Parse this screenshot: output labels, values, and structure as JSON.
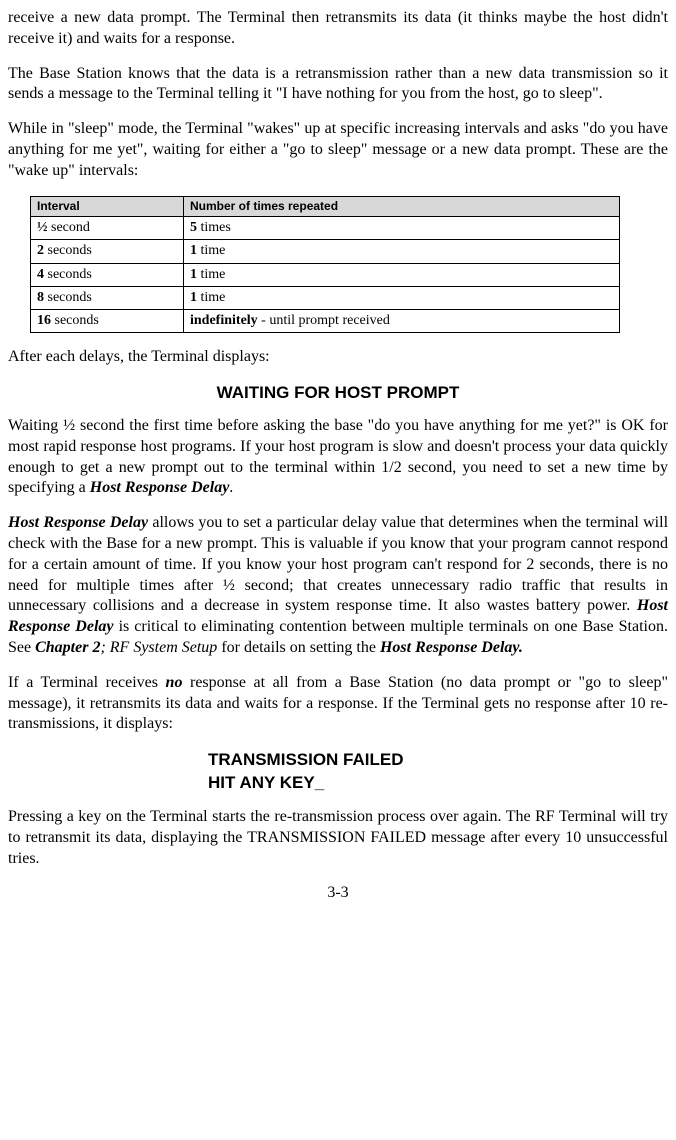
{
  "paragraphs": {
    "p1": "receive a new data prompt. The Terminal then retransmits its data (it thinks maybe the host didn't receive it) and waits for a response.",
    "p2": "The Base Station knows that the data is a retransmission rather than a new data transmission so it sends a message to the Terminal telling it \"I have nothing for you from the host, go to sleep\".",
    "p3": "While in \"sleep\" mode, the Terminal \"wakes\" up at specific increasing intervals and asks \"do you have anything for me yet\", waiting for either a \"go to sleep\" message or a new data prompt.  These are the \"wake up\" intervals:",
    "p4": "After each delays, the Terminal displays:",
    "p5a": "Waiting ½ second the first time before asking the base \"do you have anything for me yet?\" is OK for most rapid response host programs.  If your host program is slow and doesn't process your data quickly enough to get a new prompt out to the terminal within 1/2 second, you need to set a new time by specifying a ",
    "p5b": "Host Response Delay",
    "p5c": ".",
    "p6a": "Host Response Delay",
    "p6b": " allows you to set a particular delay value that determines when the terminal will check with the Base for a new prompt.  This is valuable if you know that your program cannot respond for a certain amount of time. If you know your host program can't respond for 2 seconds, there is no need for multiple times after ½ second; that creates unnecessary radio traffic that results in unnecessary collisions and a decrease in system response time. It also wastes battery power. ",
    "p6c": "Host Response Delay",
    "p6d": " is critical to eliminating contention between multiple terminals on one Base Station. See ",
    "p6e": "Chapter 2",
    "p6f": "; RF System Setup",
    "p6g": " for details on setting the ",
    "p6h": "Host Response Delay.",
    "p7a": "If a Terminal receives ",
    "p7b": "no",
    "p7c": " response at all from a Base Station (no data prompt or \"go to sleep\" message), it retransmits its data and waits for a response. If the Terminal gets no response after 10 re-transmissions, it displays:",
    "p8": "Pressing a key on the Terminal starts the re-transmission process over again. The RF Terminal will try to retransmit its data, displaying the TRANSMISSION FAILED message after every 10 unsuccessful tries."
  },
  "table": {
    "headers": {
      "c1": "Interval",
      "c2": "Number of times repeated"
    },
    "rows": [
      {
        "c1a": "½",
        "c1b": " second",
        "c2a": "5",
        "c2b": " times"
      },
      {
        "c1a": "2",
        "c1b": " seconds",
        "c2a": "1",
        "c2b": " time"
      },
      {
        "c1a": "4",
        "c1b": " seconds",
        "c2a": "1",
        "c2b": " time"
      },
      {
        "c1a": "8",
        "c1b": " seconds",
        "c2a": "1",
        "c2b": " time"
      },
      {
        "c1a": "16",
        "c1b": " seconds",
        "c2a": "indefinitely",
        "c2b": " - until prompt received"
      }
    ]
  },
  "display1": "WAITING FOR HOST PROMPT",
  "display2a": "TRANSMISSION FAILED",
  "display2b": "HIT ANY KEY_",
  "page": "3-3"
}
